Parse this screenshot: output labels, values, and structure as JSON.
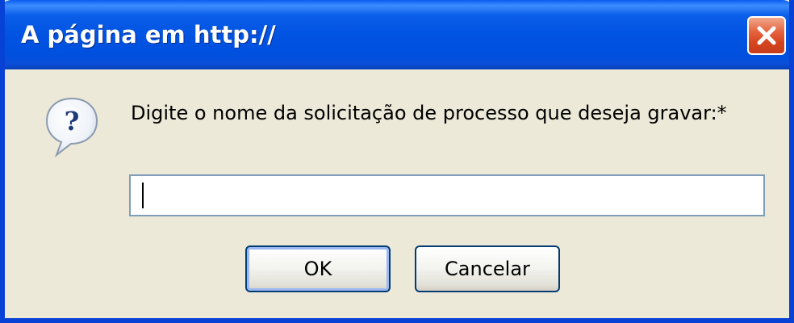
{
  "window": {
    "title": "A página em http://"
  },
  "dialog": {
    "prompt": "Digite o nome da solicitação de processo que deseja gravar:*",
    "input": {
      "value": "",
      "placeholder": ""
    },
    "buttons": {
      "ok_label": "OK",
      "cancel_label": "Cancelar"
    }
  },
  "icons": {
    "close": "close-icon",
    "question": "question-icon"
  },
  "colors": {
    "titlebar": "#0153E2",
    "dialog_bg": "#ECE9D8",
    "close_button": "#D5451F",
    "input_border": "#7F9DB9",
    "button_border": "#003C74"
  }
}
